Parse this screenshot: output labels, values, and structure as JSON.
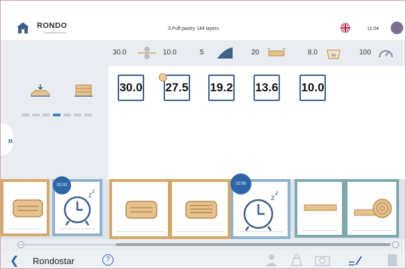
{
  "header": {
    "brand": "RONDO",
    "brand_sub": "Doughlinedurance",
    "program_title": "3.Puff pastry 144 layers",
    "time": "11:04",
    "language_icon": "uk-flag-icon",
    "user_icon": "user-avatar-icon"
  },
  "params": {
    "roller_start": "30.0",
    "roller_end": "10.0",
    "speed_level": "5",
    "belt_value": "20",
    "flour_value": "8.0",
    "flour_badge": "SG",
    "speed_percent": "100"
  },
  "thickness_steps": [
    "30.0",
    "27.5",
    "19.2",
    "13.6",
    "10.0"
  ],
  "timers": {
    "first": "02:03",
    "second": "02:00"
  },
  "footer": {
    "machine_name": "Rondostar",
    "help_label": "?"
  },
  "colors": {
    "accent": "#2c66a8",
    "dough_card": "#d7a968",
    "rest_card": "#8fb2cf",
    "finish_card": "#7ea8ae"
  }
}
